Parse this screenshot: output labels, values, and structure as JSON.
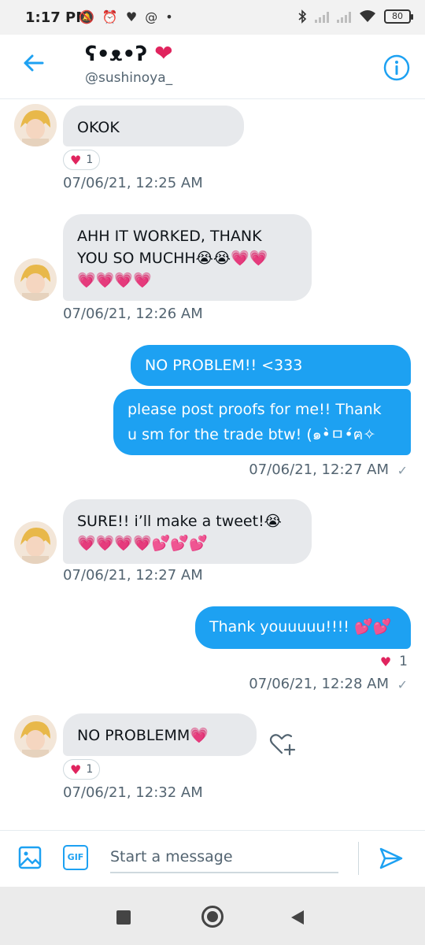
{
  "status_bar": {
    "time": "1:17 PM",
    "left_icons": [
      "muted-bell-icon",
      "alarm-icon",
      "heart-icon",
      "at-icon",
      "dot-icon"
    ],
    "right_icons": [
      "bluetooth-icon",
      "signal-icon",
      "signal-icon",
      "wifi-icon",
      "battery-icon"
    ],
    "battery": "80"
  },
  "header": {
    "display_name": "ʕ•ᴥ•ʔ",
    "name_heart": "❤",
    "handle": "@sushinoya_",
    "accent": "#1da1f2"
  },
  "messages": {
    "m1": {
      "text": "OKOK",
      "reaction_count": "1",
      "time": "07/06/21, 12:25 AM"
    },
    "m2": {
      "line1": "AHH IT WORKED, THANK",
      "line2": "YOU SO MUCHH😭😭💗💗",
      "line3": "💗💗💗💗",
      "time": "07/06/21, 12:26 AM"
    },
    "m3": {
      "text": "NO PROBLEM!! <333"
    },
    "m4": {
      "line1": "please post proofs for me!! Thank",
      "line2": "u sm for the trade btw! (๑•̀ㅁ•́ฅ✧",
      "time": "07/06/21, 12:27 AM",
      "status": "✓"
    },
    "m5": {
      "line1": "SURE!! i’ll make a tweet!😭",
      "line2": "💗💗💗💗💕💕💕",
      "time": "07/06/21, 12:27 AM"
    },
    "m6": {
      "text": "Thank youuuuu!!!! 💕💕",
      "reaction_count": "1",
      "time": "07/06/21, 12:28 AM",
      "status": "✓"
    },
    "m7": {
      "text": "NO PROBLEMM💗",
      "reaction_count": "1",
      "time": "07/06/21, 12:32 AM"
    }
  },
  "composer": {
    "placeholder": "Start a message",
    "gif_label": "GIF"
  },
  "colors": {
    "incoming_bubble": "#e7e9ec",
    "outgoing_bubble": "#1da1f2",
    "heart": "#e0245e"
  }
}
